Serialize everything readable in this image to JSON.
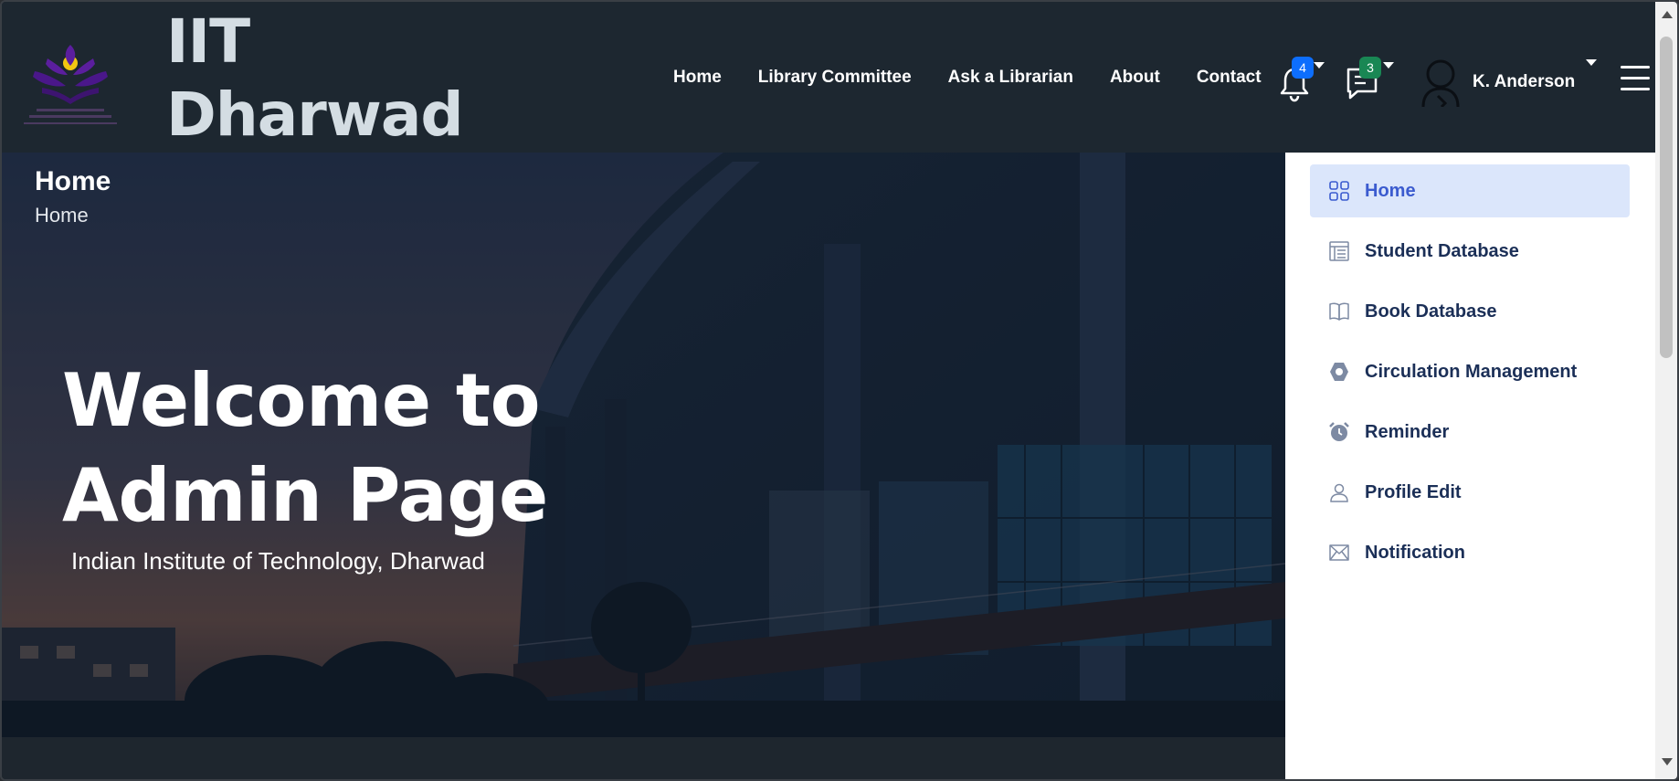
{
  "brand": {
    "line1": "IIT",
    "line2": "Dharwad"
  },
  "nav": {
    "links": [
      "Home",
      "Library Committee",
      "Ask a Librarian",
      "About",
      "Contact"
    ]
  },
  "notifications": {
    "count": "4",
    "color": "#0d6efd",
    "icon": "bell-icon"
  },
  "messages": {
    "count": "3",
    "color": "#198754",
    "icon": "chat-icon"
  },
  "user": {
    "name": "K. Anderson",
    "icon": "avatar-icon"
  },
  "page": {
    "title": "Home",
    "breadcrumb": "Home"
  },
  "hero": {
    "heading": "Welcome to Admin Page",
    "subtitle": "Indian Institute of Technology, Dharwad"
  },
  "sidemenu": {
    "items": [
      {
        "label": "Home",
        "icon": "grid-icon",
        "active": true
      },
      {
        "label": "Student Database",
        "icon": "document-list-icon",
        "active": false
      },
      {
        "label": "Book Database",
        "icon": "open-book-icon",
        "active": false
      },
      {
        "label": "Circulation Management",
        "icon": "hexagon-icon",
        "active": false
      },
      {
        "label": "Reminder",
        "icon": "alarm-clock-icon",
        "active": false
      },
      {
        "label": "Profile Edit",
        "icon": "person-icon",
        "active": false
      },
      {
        "label": "Notification",
        "icon": "envelope-icon",
        "active": false
      }
    ],
    "accent": "#3b5bcf",
    "active_bg": "#dbe6fb"
  }
}
